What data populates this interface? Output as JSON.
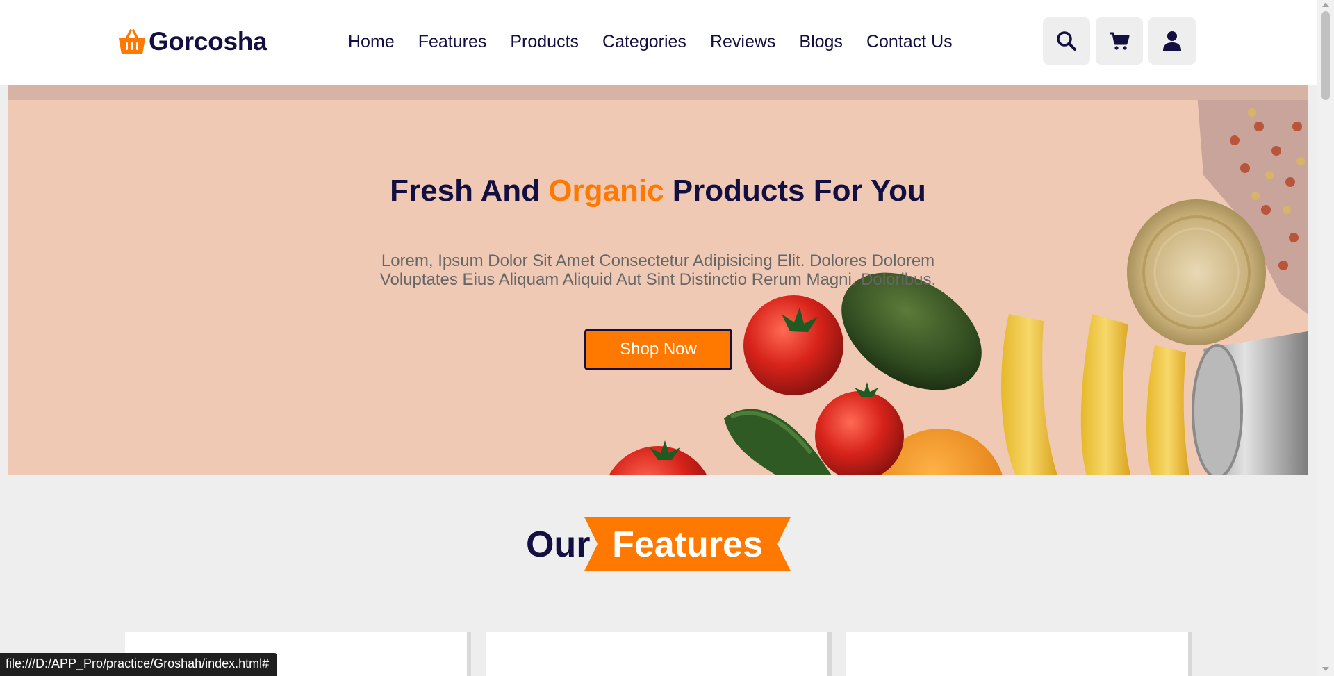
{
  "header": {
    "logo_text": "Gorcosha",
    "nav": [
      "Home",
      "Features",
      "Products",
      "Categories",
      "Reviews",
      "Blogs",
      "Contact Us"
    ],
    "icons": [
      "search-icon",
      "cart-icon",
      "user-icon"
    ]
  },
  "hero": {
    "title_before": "Fresh And ",
    "title_accent": "Organic",
    "title_after": " Products For You",
    "description": "Lorem, Ipsum Dolor Sit Amet Consectetur Adipisicing Elit. Dolores Dolorem Voluptates Eius Aliquam Aliquid Aut Sint Distinctio Rerum Magni. Doloribus.",
    "button_label": "Shop Now"
  },
  "features": {
    "heading_plain": "Our",
    "heading_accent": "Features"
  },
  "status_bar": {
    "url": "file:///D:/APP_Pro/practice/Groshah/index.html#"
  },
  "colors": {
    "primary": "#ff7800",
    "dark": "#130f40",
    "hero_bg": "#efc9b4",
    "page_bg": "#eeeeee"
  }
}
